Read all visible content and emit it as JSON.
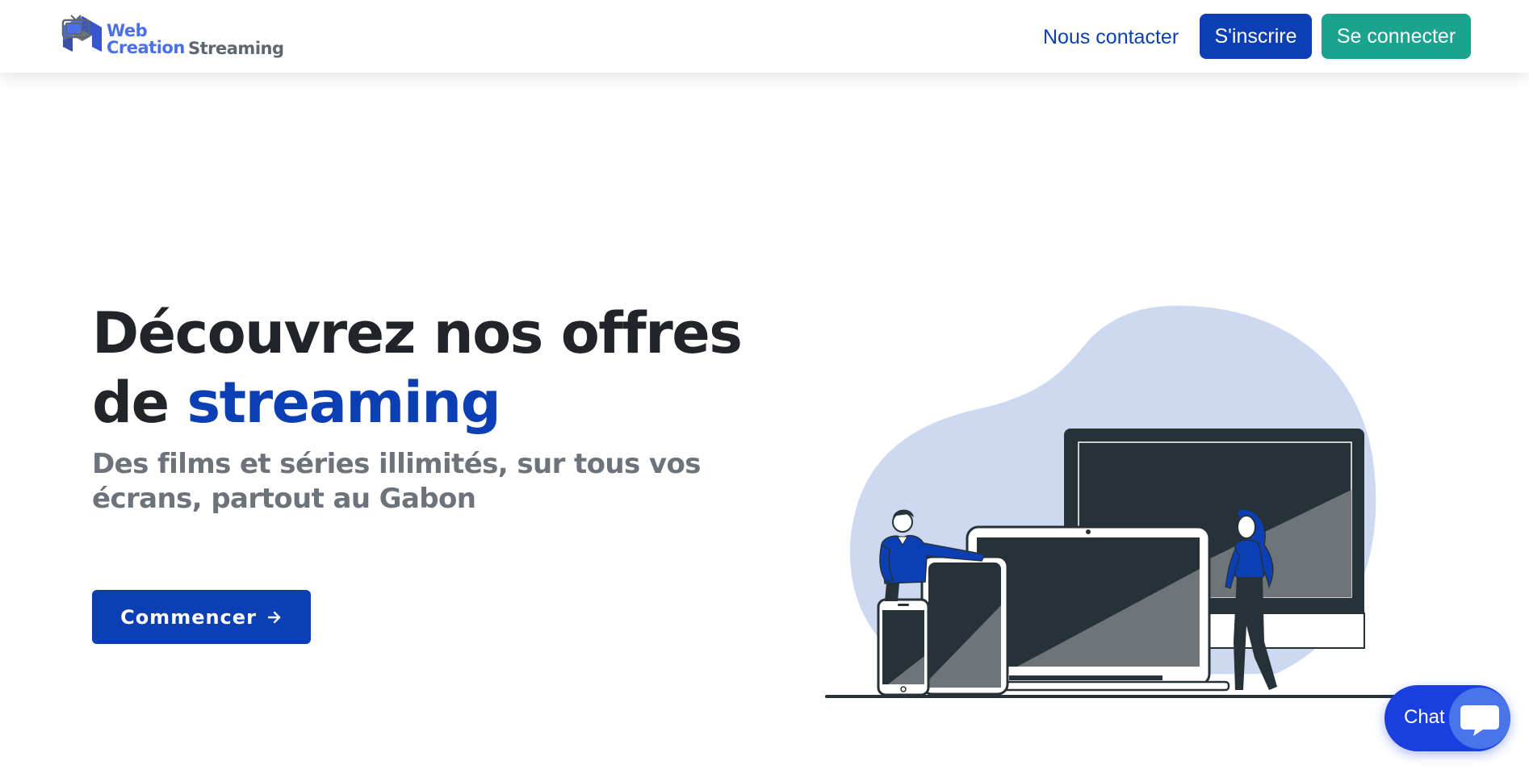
{
  "brand": {
    "line1": "Web",
    "line2": "Creation",
    "line3": "Streaming",
    "colors": {
      "primary": "#4a6fe6",
      "secondary": "#5e6770"
    }
  },
  "nav": {
    "contact_label": "Nous contacter",
    "signup_label": "S'inscrire",
    "login_label": "Se connecter"
  },
  "hero": {
    "title_prefix": "Découvrez nos offres de",
    "title_accent": "streaming",
    "subtitle": "Des films et séries illimités, sur tous vos écrans, partout au Gabon",
    "cta_label": "Commencer"
  },
  "chat": {
    "label": "Chat"
  },
  "icons": {
    "logo": "house-logo-icon",
    "tv": "tv-icon",
    "arrow": "arrow-right-icon",
    "chat": "chat-bubble-icon"
  },
  "colors": {
    "primary_blue": "#0b3fb3",
    "teal": "#1aa38f",
    "blob": "#cdd9f1",
    "device_dark": "#263238",
    "chat_blue": "#1a3fe0"
  }
}
